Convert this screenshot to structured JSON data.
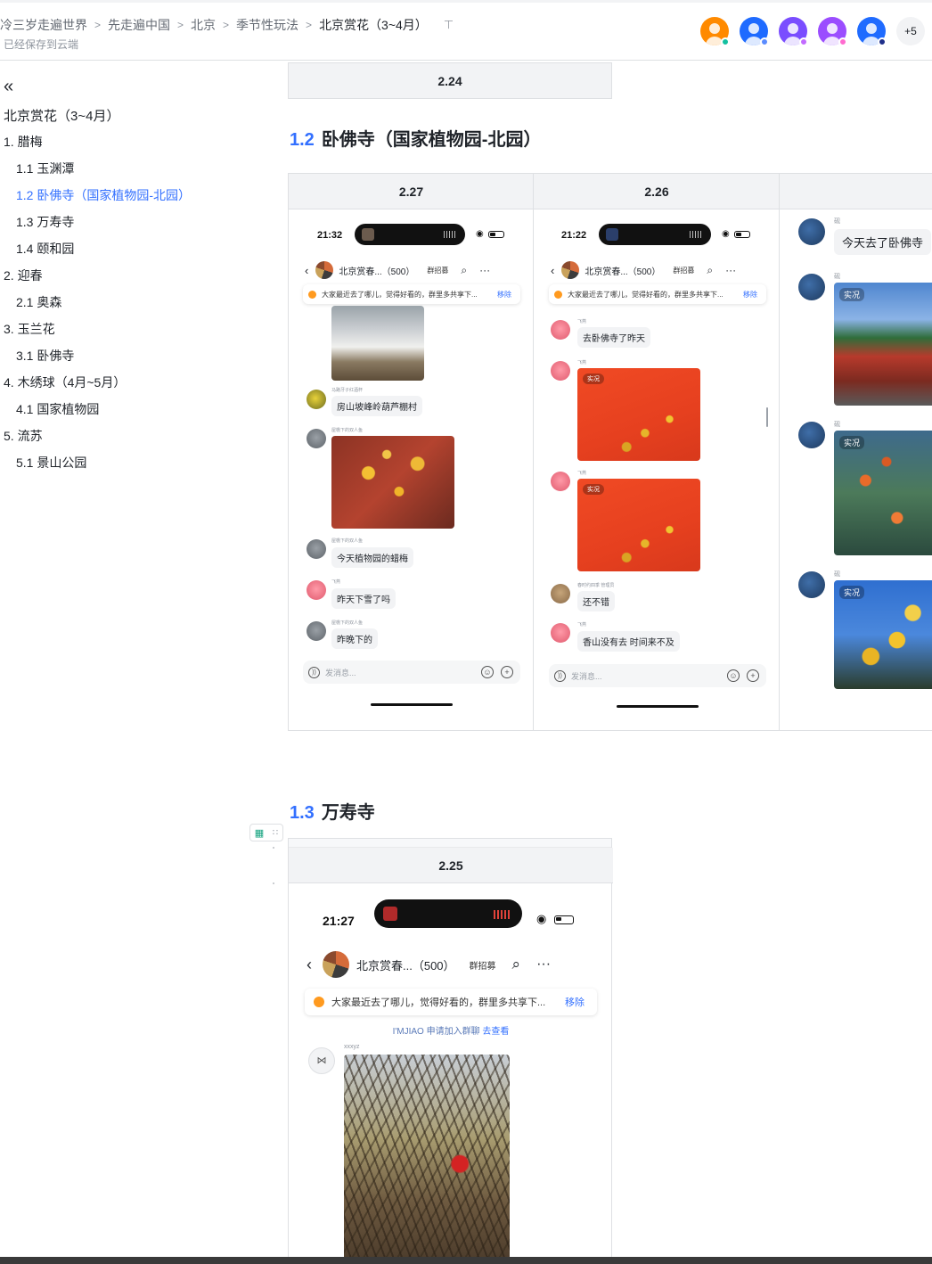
{
  "header": {
    "breadcrumb": [
      "冷三岁走遍世界",
      "先走遍中国",
      "北京",
      "季节性玩法",
      "北京赏花（3~4月）"
    ],
    "save_status": "已经保存到云端",
    "collaborators": [
      {
        "color": "#ff8a00",
        "dot": "#14c0a0"
      },
      {
        "color": "#1f6bff",
        "dot": "#5b8cff"
      },
      {
        "color": "#7a4dff",
        "dot": "#c26bff"
      },
      {
        "color": "#9b4dff",
        "dot": "#ff6bd0"
      },
      {
        "color": "#1f6bff",
        "dot": "#1f2f8a"
      }
    ],
    "more_count": "+5"
  },
  "sidebar": {
    "title": "北京赏花（3~4月）",
    "items": [
      {
        "label": "1. 腊梅",
        "level": 1
      },
      {
        "label": "1.1 玉渊潭",
        "level": 2
      },
      {
        "label": "1.2 卧佛寺（国家植物园-北园）",
        "level": 2,
        "active": true
      },
      {
        "label": "1.3 万寿寺",
        "level": 2
      },
      {
        "label": "1.4 颐和园",
        "level": 2
      },
      {
        "label": "2. 迎春",
        "level": 1
      },
      {
        "label": "2.1 奥森",
        "level": 2
      },
      {
        "label": "3. 玉兰花",
        "level": 1
      },
      {
        "label": "3.1 卧佛寺",
        "level": 2
      },
      {
        "label": "4. 木绣球（4月~5月）",
        "level": 1
      },
      {
        "label": "4.1 国家植物园",
        "level": 2
      },
      {
        "label": "5. 流苏",
        "level": 1
      },
      {
        "label": "5.1 景山公园",
        "level": 2
      }
    ]
  },
  "content": {
    "top_cell_date": "2.24",
    "section_12": {
      "num": "1.2",
      "title": "卧佛寺（国家植物园-北园）"
    },
    "table_12_headers": [
      "2.27",
      "2.26",
      ""
    ],
    "section_13": {
      "num": "1.3",
      "title": "万寿寺"
    },
    "table_13_header": "2.25"
  },
  "phone1": {
    "time": "21:32",
    "group_name": "北京赏春...（500）",
    "recruit": "群招募",
    "notice": "大家最近去了哪儿，觉得好看的，群里多共享下...",
    "notice_remove": "移除",
    "messages": [
      {
        "name": "马路牙子红酒杯",
        "text": "房山坡峰岭葫芦棚村"
      },
      {
        "name": "屋檐下的双人鱼",
        "text": ""
      },
      {
        "name": "屋檐下的双人鱼",
        "text": "今天植物园的蜡梅"
      },
      {
        "name": "飞燕",
        "text": "昨天下雪了吗"
      },
      {
        "name": "屋檐下的双人鱼",
        "text": "昨晚下的"
      }
    ],
    "input_placeholder": "发消息..."
  },
  "phone2": {
    "time": "21:22",
    "group_name": "北京赏春...（500）",
    "recruit": "群招募",
    "notice": "大家最近去了哪儿，觉得好看的，群里多共享下...",
    "notice_remove": "移除",
    "messages": [
      {
        "name": "飞燕",
        "text": "去卧佛寺了昨天"
      },
      {
        "name": "飞燕",
        "text": ""
      },
      {
        "name": "飞燕",
        "text": ""
      },
      {
        "name": "春时约四季   管理员",
        "text": "还不错"
      },
      {
        "name": "飞燕",
        "text": "香山没有去 时间来不及"
      }
    ],
    "live_label": "实况",
    "input_placeholder": "发消息..."
  },
  "phone3": {
    "messages": [
      {
        "name": "砚",
        "text": "今天去了卧佛寺"
      },
      {
        "name": "砚",
        "text": ""
      },
      {
        "name": "砚",
        "text": ""
      },
      {
        "name": "砚",
        "text": ""
      }
    ],
    "live_label": "实况"
  },
  "phone4": {
    "time": "21:27",
    "group_name": "北京赏春...（500）",
    "recruit": "群招募",
    "notice": "大家最近去了哪儿，觉得好看的，群里多共享下...",
    "notice_remove": "移除",
    "join_text": "I'MJIAO 申请加入群聊",
    "join_link": "去查看",
    "sender": "xxxyz"
  }
}
